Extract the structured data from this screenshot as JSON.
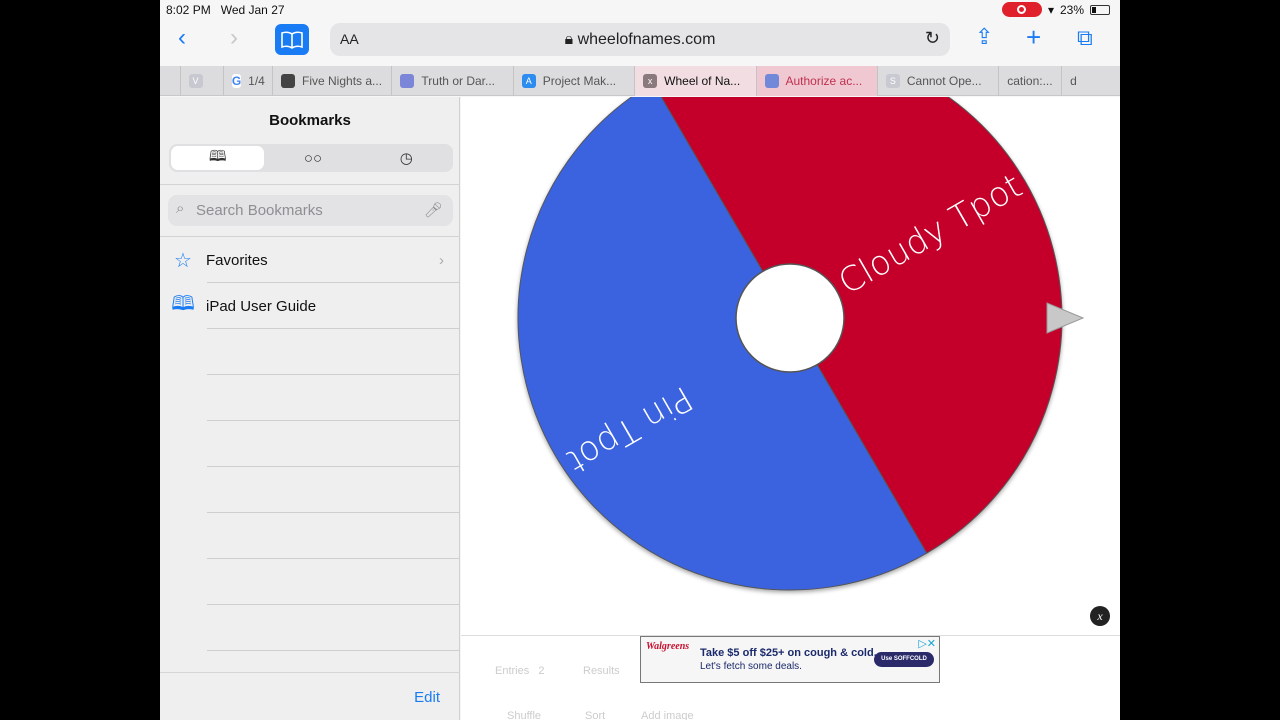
{
  "status": {
    "time": "8:02 PM",
    "date": "Wed Jan 27",
    "battery": "23%"
  },
  "toolbar": {
    "aa": "AA",
    "url": "wheelofnames.com"
  },
  "tabs": [
    {
      "label": "",
      "favicon": "V",
      "color": "#c8c8d0"
    },
    {
      "label": "1/4",
      "favicon": "G",
      "color": "#ffffff"
    },
    {
      "label": "Five Nights a...",
      "favicon": "roblox",
      "color": "#444"
    },
    {
      "label": "Truth or Dar...",
      "favicon": "bot",
      "color": "#7b86d9"
    },
    {
      "label": "Project Mak...",
      "favicon": "A",
      "color": "#2d8cf0"
    },
    {
      "label": "Wheel of Na...",
      "favicon": "x",
      "color": "#8a7a7c",
      "active": true
    },
    {
      "label": "Authorize ac...",
      "favicon": "discord",
      "color": "#7289da",
      "pink": true
    },
    {
      "label": "Cannot Ope...",
      "favicon": "S",
      "color": "#c9c9d2"
    },
    {
      "label": "cation:...",
      "favicon": "",
      "color": ""
    },
    {
      "label": "d",
      "favicon": "",
      "color": ""
    }
  ],
  "sidebar": {
    "title": "Bookmarks",
    "search_placeholder": "Search Bookmarks",
    "items": [
      {
        "label": "Favorites",
        "icon": "star-icon"
      },
      {
        "label": "iPad User Guide",
        "icon": "book-icon"
      }
    ],
    "edit": "Edit"
  },
  "wheel": {
    "segments": [
      {
        "label": "Cloudy Tpot",
        "color": "#c4002a"
      },
      {
        "label": "Pin Tpot",
        "color": "#3a63e0"
      }
    ]
  },
  "ad": {
    "brand": "Walgreens",
    "headline": "Take $5 off $25+ on cough & cold.",
    "sub": "Let's fetch some deals.",
    "cta": "Use SOFFCOLD"
  },
  "lower": {
    "entries": "Entries",
    "entries_count": "2",
    "results": "Results",
    "shuffle": "Shuffle",
    "sort": "Sort",
    "add_image": "Add image"
  }
}
